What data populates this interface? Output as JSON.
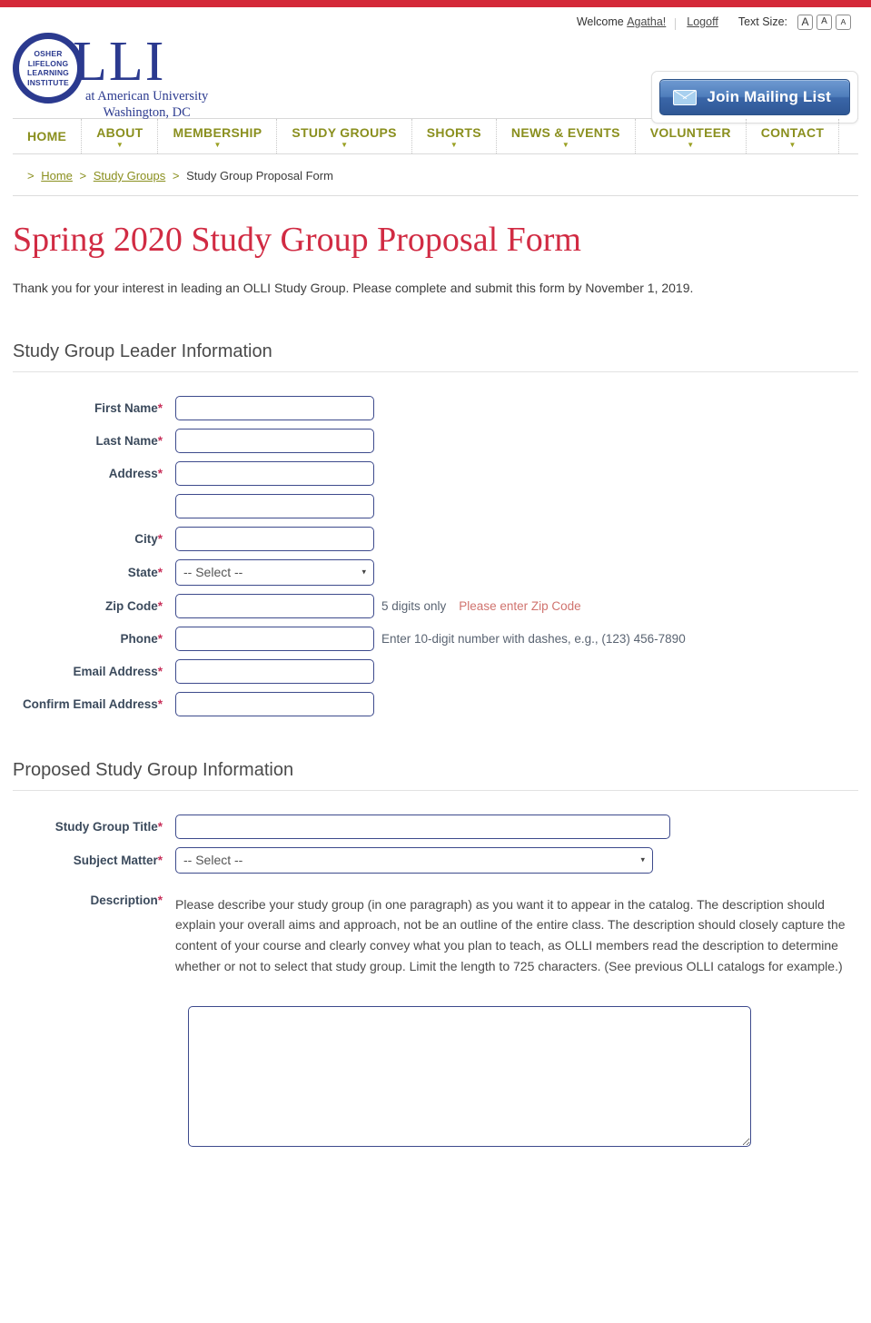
{
  "topbar": {
    "accent_color": "#d42938"
  },
  "utility": {
    "welcome_text": "Welcome",
    "user_name": "Agatha!",
    "logoff_label": "Logoff",
    "text_size_label": "Text Size:",
    "text_size_buttons": [
      "A",
      "A",
      "A"
    ]
  },
  "logo": {
    "circle_text": "OSHER\nLIFELONG\nLEARNING\nINSTITUTE",
    "wordmark": "LLI",
    "affiliation_line1": "at American University",
    "affiliation_line2": "Washington, DC",
    "brand_color": "#2b3a8f"
  },
  "mailing_list": {
    "label": "Join Mailing List",
    "icon": "envelope-icon"
  },
  "nav": {
    "items": [
      {
        "label": "HOME",
        "has_dropdown": false
      },
      {
        "label": "ABOUT",
        "has_dropdown": true
      },
      {
        "label": "MEMBERSHIP",
        "has_dropdown": true
      },
      {
        "label": "STUDY GROUPS",
        "has_dropdown": true
      },
      {
        "label": "SHORTS",
        "has_dropdown": true
      },
      {
        "label": "NEWS & EVENTS",
        "has_dropdown": true
      },
      {
        "label": "VOLUNTEER",
        "has_dropdown": true
      },
      {
        "label": "CONTACT",
        "has_dropdown": true
      }
    ],
    "color": "#8a8f1e"
  },
  "breadcrumb": {
    "lead": ">",
    "home": "Home",
    "sep": ">",
    "parent": "Study Groups",
    "current": "Study Group Proposal Form"
  },
  "page": {
    "title": "Spring 2020 Study Group Proposal Form",
    "title_color": "#d12b43",
    "intro": "Thank you for your interest in leading an OLLI Study Group. Please complete and submit this form by November 1, 2019."
  },
  "section_leader": {
    "heading": "Study Group Leader Information",
    "fields": {
      "first_name": {
        "label": "First Name",
        "required": "*",
        "value": ""
      },
      "last_name": {
        "label": "Last Name",
        "required": "*",
        "value": ""
      },
      "address1": {
        "label": "Address",
        "required": "*",
        "value": ""
      },
      "address2": {
        "label": "",
        "required": "",
        "value": ""
      },
      "city": {
        "label": "City",
        "required": "*",
        "value": ""
      },
      "state": {
        "label": "State",
        "required": "*",
        "selected": "-- Select --",
        "caret": "▾"
      },
      "zip": {
        "label": "Zip Code",
        "required": "*",
        "value": "",
        "hint": "5 digits only",
        "error": "Please enter Zip Code"
      },
      "phone": {
        "label": "Phone",
        "required": "*",
        "value": "",
        "hint": "Enter 10-digit number with dashes, e.g., (123) 456-7890"
      },
      "email": {
        "label": "Email Address",
        "required": "*",
        "value": ""
      },
      "confirm_email": {
        "label": "Confirm Email Address",
        "required": "*",
        "value": ""
      }
    }
  },
  "section_group": {
    "heading": "Proposed Study Group Information",
    "fields": {
      "title": {
        "label": "Study Group Title",
        "required": "*",
        "value": ""
      },
      "subject": {
        "label": "Subject Matter",
        "required": "*",
        "selected": "-- Select --",
        "caret": "▾"
      },
      "description": {
        "label": "Description",
        "required": "*",
        "instructions": "Please describe your study group (in one paragraph) as you want it to appear in the catalog. The description should explain your overall aims and approach, not be an outline of the entire class. The description should closely capture the content of your course and clearly convey what you plan to teach, as OLLI members read the description to determine whether or not to select that study group. Limit the length to 725 characters. (See previous OLLI catalogs for example.)",
        "value": ""
      }
    }
  }
}
